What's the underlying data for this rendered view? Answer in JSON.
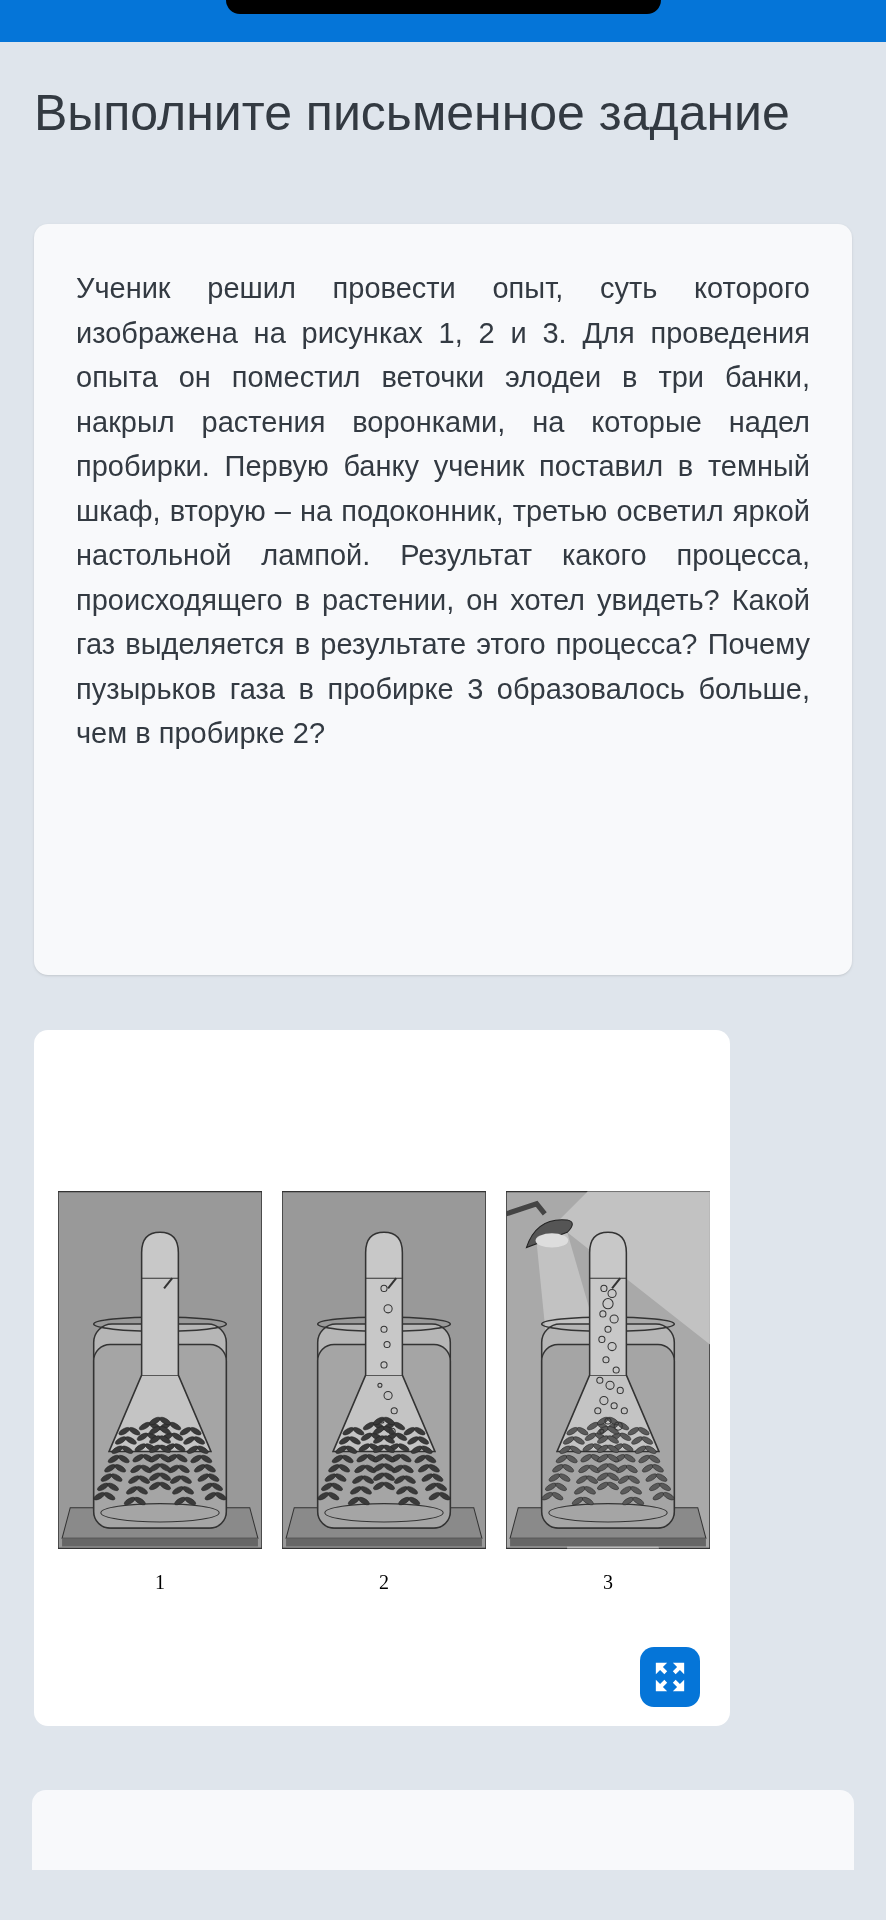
{
  "heading": "Выполните письменное задание",
  "question": "Ученик решил провести опыт, суть которого изображена на рисунках 1, 2 и 3. Для проведения опыта он поместил веточки элодеи в три банки, накрыл растения воронками, на которые надел пробирки. Первую банку ученик поставил в темный шкаф, вторую – на подоконник, третью осветил яркой настольной лампой. Результат какого процесса, происходящего в растении, он хотел увидеть? Какой газ выделяется в результате этого процесса? Почему пузырьков газа в пробирке 3 образовалось больше, чем в пробирке 2?",
  "figure": {
    "panels": [
      {
        "label": "1",
        "kind": "dark"
      },
      {
        "label": "2",
        "kind": "window"
      },
      {
        "label": "3",
        "kind": "lamp"
      }
    ]
  }
}
